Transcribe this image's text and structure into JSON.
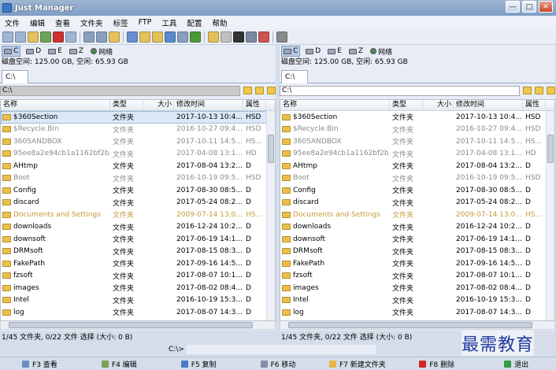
{
  "window": {
    "title": "Just Manager",
    "btn_min": "—",
    "btn_max": "□",
    "btn_close": "✕"
  },
  "menu": [
    "文件",
    "编辑",
    "查看",
    "文件夹",
    "标签",
    "FTP",
    "工具",
    "配置",
    "帮助"
  ],
  "toolbar_icons": [
    "new-icon",
    "copy-icon",
    "paste-icon",
    "move-icon",
    "delete-icon",
    "rename-icon",
    "back-icon",
    "forward-icon",
    "up-folder-icon",
    "view-icon",
    "sort-icon",
    "filter-icon",
    "layout-icon",
    "list-icon",
    "refresh-icon",
    "folder-icon",
    "search-icon",
    "terminal-icon",
    "map-drive-icon",
    "disconnect-icon",
    "settings-icon"
  ],
  "drives": [
    "C",
    "D",
    "E",
    "Z",
    "网络"
  ],
  "disk_info": "磁盘空间: 125.00 GB, 空闲: 65.93 GB",
  "tab_label": "C:\\",
  "path": "C:\\",
  "columns": {
    "name": "名称",
    "type": "类型",
    "size": "大小",
    "modified": "修改时间",
    "attr": "属性"
  },
  "left_files": [
    {
      "name": "$360Section",
      "type": "文件夹",
      "modified": "2017-10-13 10:4...",
      "attr": "HSD",
      "style": "sel"
    },
    {
      "name": "$Recycle.Bin",
      "type": "文件夹",
      "modified": "2016-10-27 09:4...",
      "attr": "HSD",
      "style": "dim"
    },
    {
      "name": "360SANDBOX",
      "type": "文件夹",
      "modified": "2017-10-11 14:5...",
      "attr": "HS...",
      "style": "dim"
    },
    {
      "name": "95ee8a2e94cb1a1162bf2b...",
      "type": "文件夹",
      "modified": "2017-04-08 13:1...",
      "attr": "HD",
      "style": "dim"
    },
    {
      "name": "AHtmp",
      "type": "文件夹",
      "modified": "2017-08-04 13:2...",
      "attr": "D",
      "style": ""
    },
    {
      "name": "Boot",
      "type": "文件夹",
      "modified": "2016-10-19 09:5...",
      "attr": "HSD",
      "style": "dim"
    },
    {
      "name": "Config",
      "type": "文件夹",
      "modified": "2017-08-30 08:5...",
      "attr": "D",
      "style": ""
    },
    {
      "name": "discard",
      "type": "文件夹",
      "modified": "2017-05-24 08:2...",
      "attr": "D",
      "style": ""
    },
    {
      "name": "Documents and Settings",
      "type": "文件夹",
      "modified": "2009-07-14 13:0...",
      "attr": "HS...",
      "style": "sys"
    },
    {
      "name": "downloads",
      "type": "文件夹",
      "modified": "2016-12-24 10:2...",
      "attr": "D",
      "style": ""
    },
    {
      "name": "downsoft",
      "type": "文件夹",
      "modified": "2017-06-19 14:1...",
      "attr": "D",
      "style": ""
    },
    {
      "name": "DRMsoft",
      "type": "文件夹",
      "modified": "2017-08-15 08:3...",
      "attr": "D",
      "style": ""
    },
    {
      "name": "FakePath",
      "type": "文件夹",
      "modified": "2017-09-16 14:5...",
      "attr": "D",
      "style": ""
    },
    {
      "name": "fzsoft",
      "type": "文件夹",
      "modified": "2017-08-07 10:1...",
      "attr": "D",
      "style": ""
    },
    {
      "name": "images",
      "type": "文件夹",
      "modified": "2017-08-02 08:4...",
      "attr": "D",
      "style": ""
    },
    {
      "name": "Intel",
      "type": "文件夹",
      "modified": "2016-10-19 15:3...",
      "attr": "D",
      "style": ""
    },
    {
      "name": "log",
      "type": "文件夹",
      "modified": "2017-08-07 14:3...",
      "attr": "D",
      "style": ""
    }
  ],
  "right_files": [
    {
      "name": "$360Section",
      "type": "文件夹",
      "modified": "2017-10-13 10:4...",
      "attr": "HSD",
      "style": ""
    },
    {
      "name": "$Recycle.Bin",
      "type": "文件夹",
      "modified": "2016-10-27 09:4...",
      "attr": "HSD",
      "style": "dim"
    },
    {
      "name": "360SANDBOX",
      "type": "文件夹",
      "modified": "2017-10-11 14:5...",
      "attr": "HS...",
      "style": "dim"
    },
    {
      "name": "95ee8a2e94cb1a1162bf2b...",
      "type": "文件夹",
      "modified": "2017-04-08 13:1...",
      "attr": "HD",
      "style": "dim"
    },
    {
      "name": "AHtmp",
      "type": "文件夹",
      "modified": "2017-08-04 13:2...",
      "attr": "D",
      "style": ""
    },
    {
      "name": "Boot",
      "type": "文件夹",
      "modified": "2016-10-19 09:5...",
      "attr": "HSD",
      "style": "dim"
    },
    {
      "name": "Config",
      "type": "文件夹",
      "modified": "2017-08-30 08:5...",
      "attr": "D",
      "style": ""
    },
    {
      "name": "discard",
      "type": "文件夹",
      "modified": "2017-05-24 08:2...",
      "attr": "D",
      "style": ""
    },
    {
      "name": "Documents and Settings",
      "type": "文件夹",
      "modified": "2009-07-14 13:0...",
      "attr": "HS...",
      "style": "sys"
    },
    {
      "name": "downloads",
      "type": "文件夹",
      "modified": "2016-12-24 10:2...",
      "attr": "D",
      "style": ""
    },
    {
      "name": "downsoft",
      "type": "文件夹",
      "modified": "2017-06-19 14:1...",
      "attr": "D",
      "style": ""
    },
    {
      "name": "DRMsoft",
      "type": "文件夹",
      "modified": "2017-08-15 08:3...",
      "attr": "D",
      "style": ""
    },
    {
      "name": "FakePath",
      "type": "文件夹",
      "modified": "2017-09-16 14:5...",
      "attr": "D",
      "style": ""
    },
    {
      "name": "fzsoft",
      "type": "文件夹",
      "modified": "2017-08-07 10:1...",
      "attr": "D",
      "style": ""
    },
    {
      "name": "images",
      "type": "文件夹",
      "modified": "2017-08-02 08:4...",
      "attr": "D",
      "style": ""
    },
    {
      "name": "Intel",
      "type": "文件夹",
      "modified": "2016-10-19 15:3...",
      "attr": "D",
      "style": ""
    },
    {
      "name": "log",
      "type": "文件夹",
      "modified": "2017-08-07 14:3...",
      "attr": "D",
      "style": ""
    }
  ],
  "status": "1/45 文件夹, 0/22 文件 选择 (大小: 0 B)",
  "cmd_label": "C:\\>",
  "fkeys": [
    {
      "label": "F3 查看",
      "color": "#6b8ec2"
    },
    {
      "label": "F4 编辑",
      "color": "#7aa05a"
    },
    {
      "label": "F5 复制",
      "color": "#4a7ac8"
    },
    {
      "label": "F6 移动",
      "color": "#8a8aa8"
    },
    {
      "label": "F7 新建文件夹",
      "color": "#e4b840"
    },
    {
      "label": "F8 删除",
      "color": "#cc2a2a"
    },
    {
      "label": "退出",
      "color": "#3a9a4a"
    }
  ],
  "watermark": "最需教育"
}
